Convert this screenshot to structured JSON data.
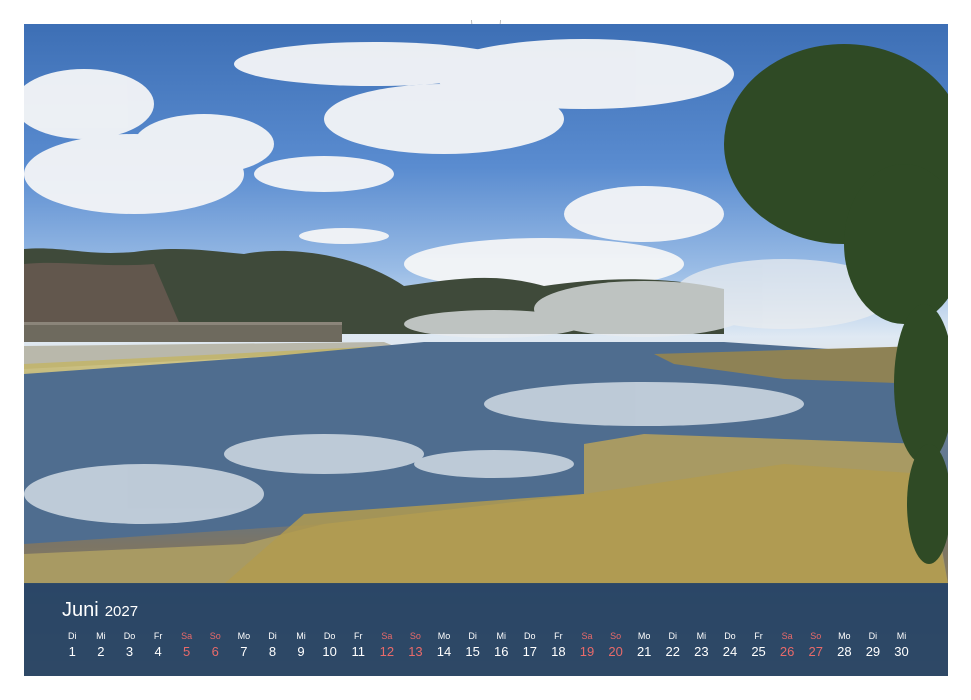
{
  "calendar": {
    "month": "Juni",
    "year": "2027",
    "weekend_color": "#e86a6a",
    "days": [
      {
        "dow": "Di",
        "num": "1",
        "weekend": false
      },
      {
        "dow": "Mi",
        "num": "2",
        "weekend": false
      },
      {
        "dow": "Do",
        "num": "3",
        "weekend": false
      },
      {
        "dow": "Fr",
        "num": "4",
        "weekend": false
      },
      {
        "dow": "Sa",
        "num": "5",
        "weekend": true
      },
      {
        "dow": "So",
        "num": "6",
        "weekend": true
      },
      {
        "dow": "Mo",
        "num": "7",
        "weekend": false
      },
      {
        "dow": "Di",
        "num": "8",
        "weekend": false
      },
      {
        "dow": "Mi",
        "num": "9",
        "weekend": false
      },
      {
        "dow": "Do",
        "num": "10",
        "weekend": false
      },
      {
        "dow": "Fr",
        "num": "11",
        "weekend": false
      },
      {
        "dow": "Sa",
        "num": "12",
        "weekend": true
      },
      {
        "dow": "So",
        "num": "13",
        "weekend": true
      },
      {
        "dow": "Mo",
        "num": "14",
        "weekend": false
      },
      {
        "dow": "Di",
        "num": "15",
        "weekend": false
      },
      {
        "dow": "Mi",
        "num": "16",
        "weekend": false
      },
      {
        "dow": "Do",
        "num": "17",
        "weekend": false
      },
      {
        "dow": "Fr",
        "num": "18",
        "weekend": false
      },
      {
        "dow": "Sa",
        "num": "19",
        "weekend": true
      },
      {
        "dow": "So",
        "num": "20",
        "weekend": true
      },
      {
        "dow": "Mo",
        "num": "21",
        "weekend": false
      },
      {
        "dow": "Di",
        "num": "22",
        "weekend": false
      },
      {
        "dow": "Mi",
        "num": "23",
        "weekend": false
      },
      {
        "dow": "Do",
        "num": "24",
        "weekend": false
      },
      {
        "dow": "Fr",
        "num": "25",
        "weekend": false
      },
      {
        "dow": "Sa",
        "num": "26",
        "weekend": true
      },
      {
        "dow": "So",
        "num": "27",
        "weekend": true
      },
      {
        "dow": "Mo",
        "num": "28",
        "weekend": false
      },
      {
        "dow": "Di",
        "num": "29",
        "weekend": false
      },
      {
        "dow": "Mi",
        "num": "30",
        "weekend": false
      }
    ]
  }
}
